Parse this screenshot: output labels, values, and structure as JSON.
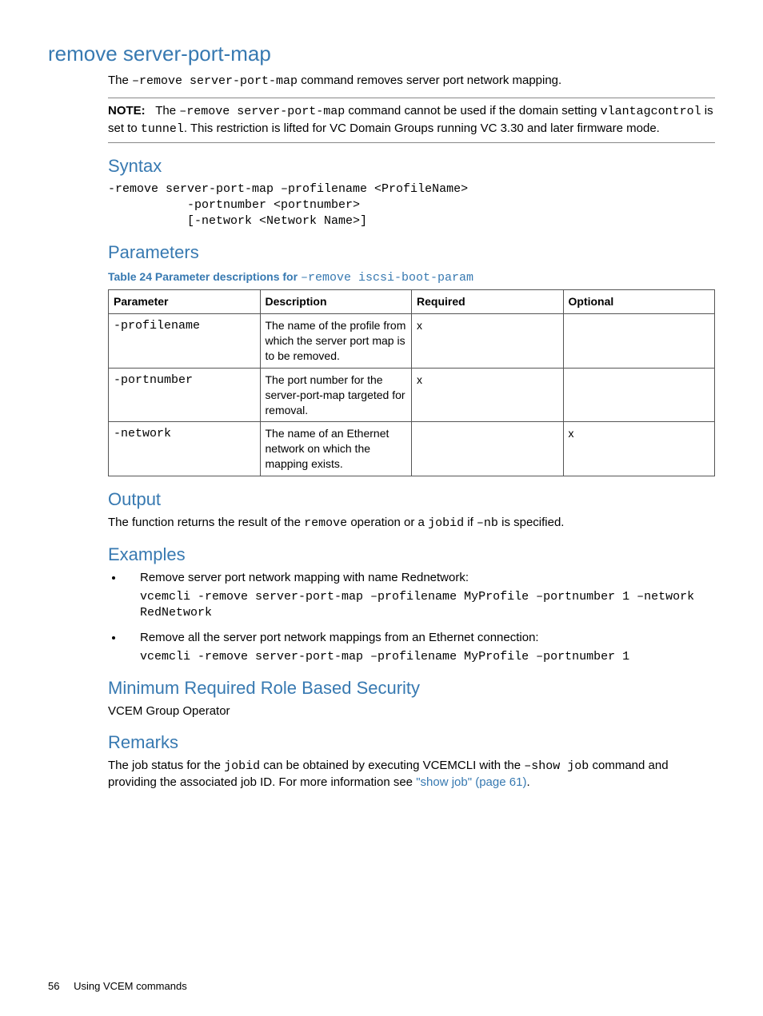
{
  "title": "remove server-port-map",
  "intro_pre": "The ",
  "intro_cmd": "–remove server-port-map",
  "intro_post": " command removes server port network mapping.",
  "note": {
    "label": "NOTE:",
    "t1": "The ",
    "cmd": "–remove server-port-map",
    "t2": " command cannot be used if the domain setting ",
    "c2": "vlantagcontrol",
    "t3": " is set to ",
    "c3": "tunnel",
    "t4": ". This restriction is lifted for VC Domain Groups running VC 3.30 and later firmware mode."
  },
  "syntax": {
    "heading": "Syntax",
    "code": "-remove server-port-map –profilename <ProfileName>\n           -portnumber <portnumber>\n           [-network <Network Name>]"
  },
  "parameters": {
    "heading": "Parameters",
    "caption_pre": "Table 24 Parameter descriptions for ",
    "caption_cmd": "–remove iscsi-boot-param",
    "headers": {
      "c1": "Parameter",
      "c2": "Description",
      "c3": "Required",
      "c4": "Optional"
    },
    "rows": [
      {
        "param": "-profilename",
        "desc": "The name of the profile from which the server port map is to be removed.",
        "req": "x",
        "opt": ""
      },
      {
        "param": "-portnumber",
        "desc": "The port number for the server-port-map targeted for removal.",
        "req": "x",
        "opt": ""
      },
      {
        "param": "-network",
        "desc": "The name of an Ethernet network on which the mapping exists.",
        "req": "",
        "opt": "x"
      }
    ]
  },
  "output": {
    "heading": "Output",
    "t1": "The function returns the result of the ",
    "c1": "remove",
    "t2": " operation or a ",
    "c2": "jobid",
    "t3": " if ",
    "c3": "–nb",
    "t4": " is specified."
  },
  "examples": {
    "heading": "Examples",
    "items": [
      {
        "desc": "Remove server port network mapping with name Rednetwork:",
        "code": "vcemcli -remove server-port-map –profilename MyProfile –portnumber 1 –network RedNetwork"
      },
      {
        "desc": "Remove all the server port network mappings from an Ethernet connection:",
        "code": "vcemcli -remove server-port-map –profilename MyProfile –portnumber 1"
      }
    ]
  },
  "security": {
    "heading": "Minimum Required Role Based Security",
    "text": "VCEM Group Operator"
  },
  "remarks": {
    "heading": "Remarks",
    "t1": "The job status for the ",
    "c1": "jobid",
    "t2": " can be obtained by executing VCEMCLI with the ",
    "c2": "–show job",
    "t3": " command and providing the associated job ID. For more information see ",
    "link": "\"show job\" (page 61)",
    "t4": "."
  },
  "footer": {
    "page": "56",
    "title": "Using VCEM commands"
  }
}
